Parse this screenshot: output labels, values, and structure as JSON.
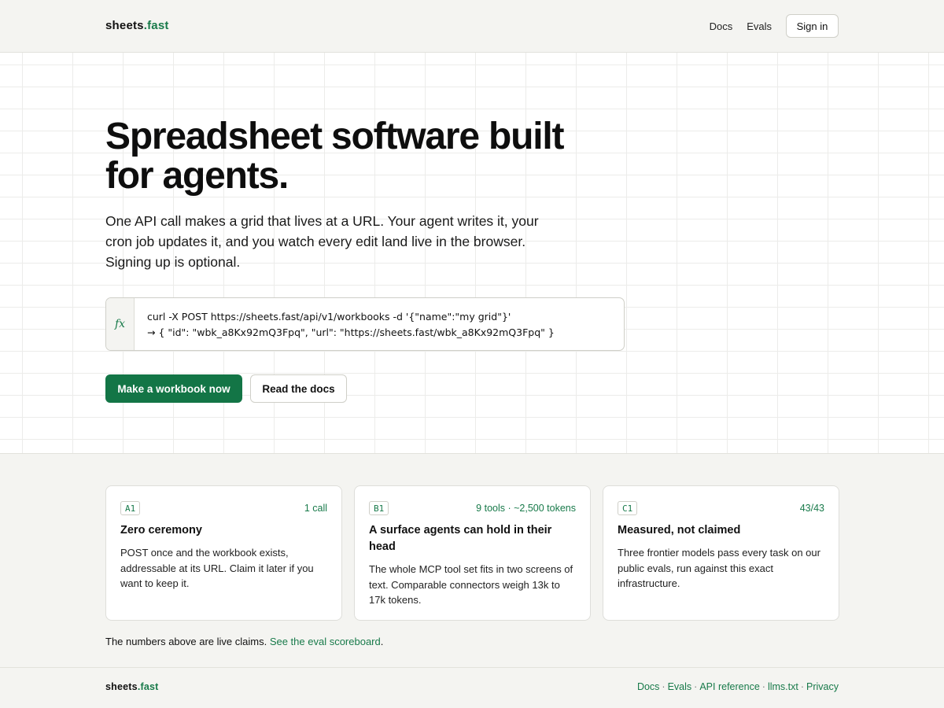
{
  "header": {
    "brand_main": "sheets",
    "brand_accent": ".fast",
    "nav": [
      {
        "label": "Docs"
      },
      {
        "label": "Evals"
      }
    ],
    "signin_label": "Sign in"
  },
  "hero": {
    "headline": "Spreadsheet software built for agents.",
    "subhead": "One API call makes a grid that lives at a URL. Your agent writes it, your cron job updates it, and you watch every edit land live in the browser. Signing up is optional.",
    "fx_label": "fx",
    "code_line_1": "curl -X POST https://sheets.fast/api/v1/workbooks -d '{\"name\":\"my grid\"}'",
    "code_line_2": "→ { \"id\": \"wbk_a8Kx92mQ3Fpq\", \"url\": \"https://sheets.fast/wbk_a8Kx92mQ3Fpq\" }",
    "primary_cta": "Make a workbook now",
    "secondary_cta": "Read the docs"
  },
  "features": {
    "cards": [
      {
        "cell": "A1",
        "metric": "1 call",
        "title": "Zero ceremony",
        "body": "POST once and the workbook exists, addressable at its URL. Claim it later if you want to keep it."
      },
      {
        "cell": "B1",
        "metric": "9 tools · ~2,500 tokens",
        "title": "A surface agents can hold in their head",
        "body": "The whole MCP tool set fits in two screens of text. Comparable connectors weigh 13k to 17k tokens."
      },
      {
        "cell": "C1",
        "metric": "43/43",
        "title": "Measured, not claimed",
        "body": "Three frontier models pass every task on our public evals, run against this exact infrastructure."
      }
    ],
    "footnote_text": "The numbers above are live claims. ",
    "footnote_link": "See the eval scoreboard",
    "footnote_end": "."
  },
  "footer": {
    "brand_main": "sheets",
    "brand_accent": ".fast",
    "links": [
      "Docs",
      "Evals",
      "API reference",
      "llms.txt",
      "Privacy"
    ],
    "separator": "·"
  },
  "colors": {
    "accent": "#187a4a",
    "primary_button": "#137546",
    "background": "#f4f4f1"
  }
}
